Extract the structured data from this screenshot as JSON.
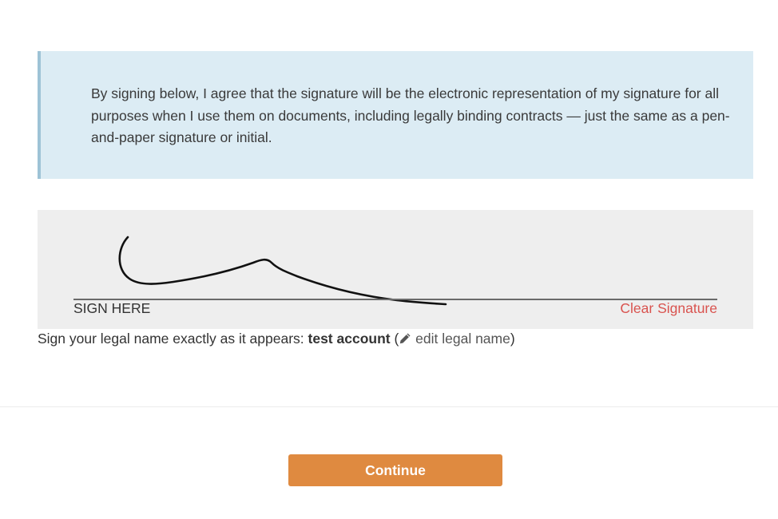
{
  "consent": {
    "text": "By signing below, I agree that the signature will be the electronic representation of my signature for all purposes when I use them on documents, including legally binding contracts — just the same as a pen-and-paper signature or initial."
  },
  "signature_pad": {
    "sign_here_label": "SIGN HERE",
    "clear_label": "Clear Signature"
  },
  "legal_name": {
    "prefix": "Sign your legal name exactly as it appears: ",
    "name": "test account",
    "open_paren": " (",
    "edit_label": " edit legal name",
    "close_paren": ")",
    "edit_icon": "pencil-icon"
  },
  "footer": {
    "continue_label": "Continue"
  },
  "colors": {
    "consent_bg": "#dcecf4",
    "consent_border": "#9ec3d6",
    "pad_bg": "#eeeeee",
    "clear_link": "#d9534f",
    "button": "#df8a40"
  }
}
